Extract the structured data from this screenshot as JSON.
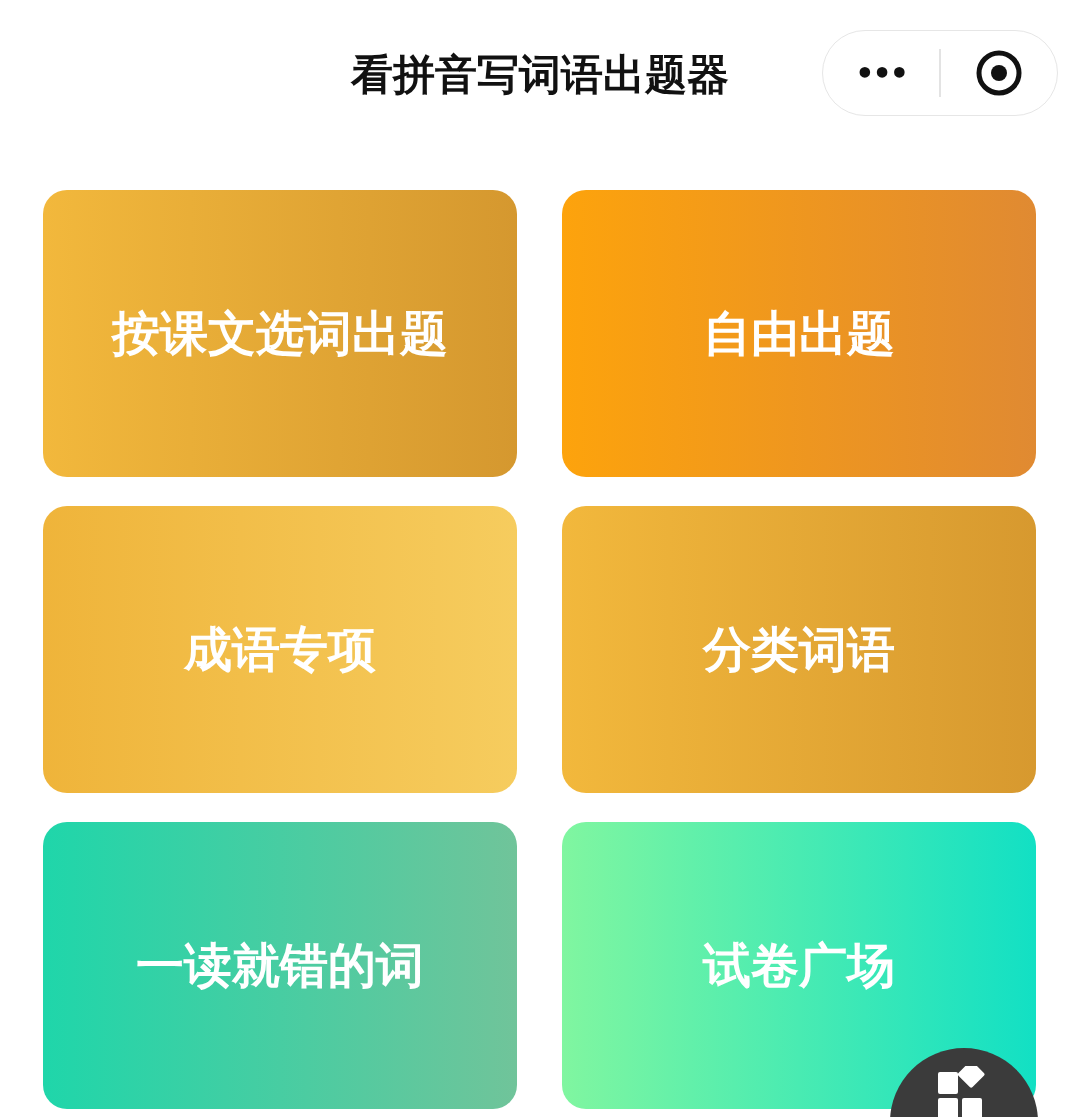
{
  "header": {
    "title": "看拼音写词语出题器",
    "capsule": {
      "more": "•••"
    }
  },
  "cards": [
    {
      "label": "按课文选词出题"
    },
    {
      "label": "自由出题"
    },
    {
      "label": "成语专项"
    },
    {
      "label": "分类词语"
    },
    {
      "label": "一读就错的词"
    },
    {
      "label": "试卷广场"
    }
  ]
}
